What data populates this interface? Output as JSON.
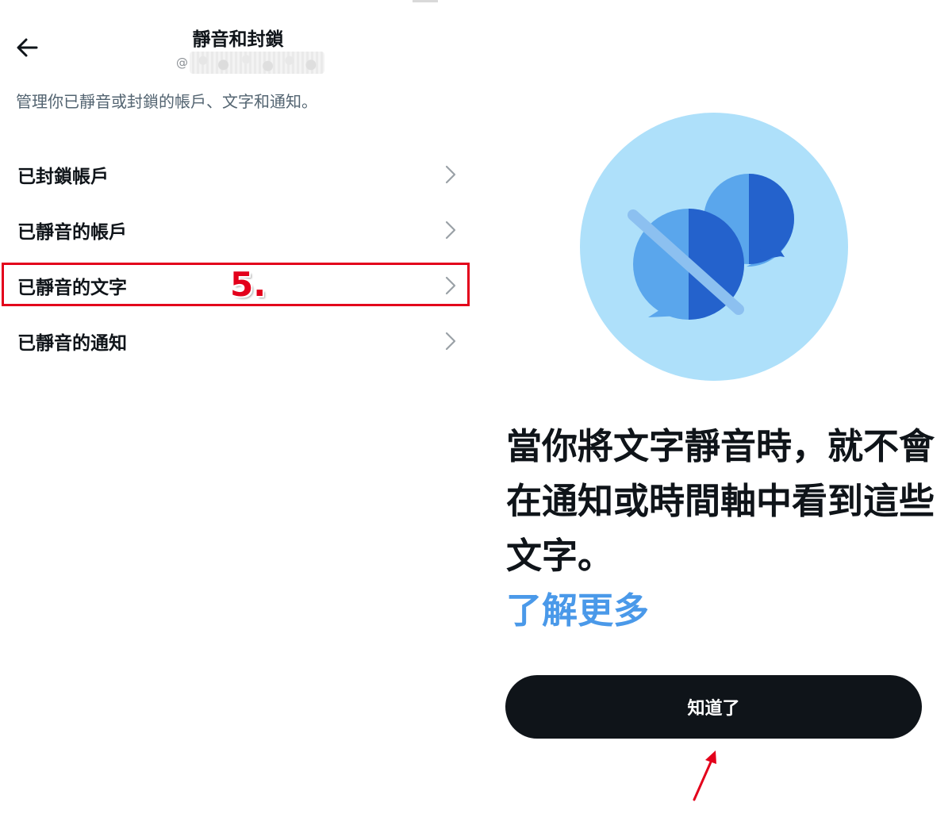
{
  "header": {
    "title": "靜音和封鎖",
    "handle_prefix": "@"
  },
  "description": "管理你已靜音或封鎖的帳戶、文字和通知。",
  "menu": {
    "items": [
      {
        "label": "已封鎖帳戶"
      },
      {
        "label": "已靜音的帳戶"
      },
      {
        "label": "已靜音的文字"
      },
      {
        "label": "已靜音的通知"
      }
    ]
  },
  "annotation": {
    "step": "5.",
    "highlight_color": "#e3001b"
  },
  "promo": {
    "text": "當你將文字靜音時，就不會在通知或時間軸中看到這些文字。",
    "learn_more": "了解更多",
    "button_label": "知道了"
  },
  "colors": {
    "accent": "#4a99e9",
    "button_bg": "#0f1419",
    "illustration_bg": "#aee0fa",
    "icon_light": "#5aa6ec",
    "icon_dark": "#2462cc"
  },
  "icons": [
    "back-arrow-icon",
    "chevron-right-icon",
    "muted-chat-illustration",
    "red-pointer-arrow-icon"
  ]
}
